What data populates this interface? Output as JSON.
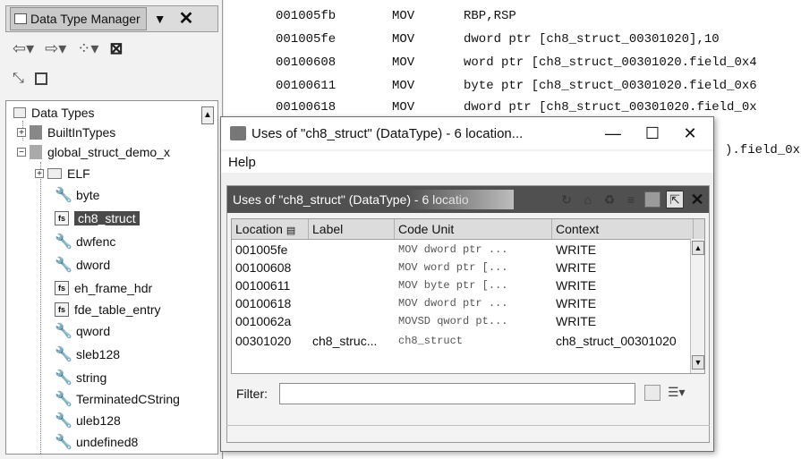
{
  "dtm": {
    "tab_title": "Data Type Manager",
    "tree_root": "Data Types",
    "tree": [
      {
        "label": "BuiltInTypes",
        "icon": "archive-icon"
      },
      {
        "label": "global_struct_demo_x",
        "icon": "program-archive-icon"
      },
      {
        "label": "ELF",
        "icon": "folder-icon"
      },
      {
        "label": "byte",
        "icon": "wrench-icon"
      },
      {
        "label": "ch8_struct",
        "icon": "struct-icon",
        "selected": true
      },
      {
        "label": "dwfenc",
        "icon": "wrench-icon"
      },
      {
        "label": "dword",
        "icon": "wrench-icon"
      },
      {
        "label": "eh_frame_hdr",
        "icon": "struct-icon"
      },
      {
        "label": "fde_table_entry",
        "icon": "struct-icon"
      },
      {
        "label": "qword",
        "icon": "wrench-icon"
      },
      {
        "label": "sleb128",
        "icon": "wrench-icon"
      },
      {
        "label": "string",
        "icon": "wrench-icon"
      },
      {
        "label": "TerminatedCString",
        "icon": "wrench-icon"
      },
      {
        "label": "uleb128",
        "icon": "wrench-icon"
      },
      {
        "label": "undefined8",
        "icon": "wrench-icon"
      }
    ]
  },
  "listing": {
    "rows": [
      {
        "addr": "001005fb",
        "mnemonic": "MOV",
        "operands": "RBP,RSP"
      },
      {
        "addr": "001005fe",
        "mnemonic": "MOV",
        "operands": "dword ptr [ch8_struct_00301020],10"
      },
      {
        "addr": "00100608",
        "mnemonic": "MOV",
        "operands": "word ptr [ch8_struct_00301020.field_0x4"
      },
      {
        "addr": "00100611",
        "mnemonic": "MOV",
        "operands": "byte ptr [ch8_struct_00301020.field_0x6"
      },
      {
        "addr": "00100618",
        "mnemonic": "MOV",
        "operands": "dword ptr [ch8_struct_00301020.field_0x"
      }
    ],
    "overflow_text": ").field_0x"
  },
  "uses_window": {
    "title": "Uses of \"ch8_struct\" (DataType) - 6 location...",
    "menu_help": "Help",
    "panel_header": "Uses of \"ch8_struct\" (DataType) - 6 locatio",
    "columns": [
      "Location",
      "Label",
      "Code Unit",
      "Context"
    ],
    "rows": [
      {
        "location": "001005fe",
        "label": "",
        "code_unit": "MOV dword ptr ...",
        "context": "WRITE"
      },
      {
        "location": "00100608",
        "label": "",
        "code_unit": "MOV word ptr [...",
        "context": "WRITE"
      },
      {
        "location": "00100611",
        "label": "",
        "code_unit": "MOV byte ptr [...",
        "context": "WRITE"
      },
      {
        "location": "00100618",
        "label": "",
        "code_unit": "MOV dword ptr ...",
        "context": "WRITE"
      },
      {
        "location": "0010062a",
        "label": "",
        "code_unit": "MOVSD qword pt...",
        "context": "WRITE"
      },
      {
        "location": "00301020",
        "label": "ch8_struc...",
        "code_unit": "ch8_struct",
        "context": "ch8_struct_00301020"
      }
    ],
    "filter_label": "Filter:",
    "filter_value": ""
  }
}
